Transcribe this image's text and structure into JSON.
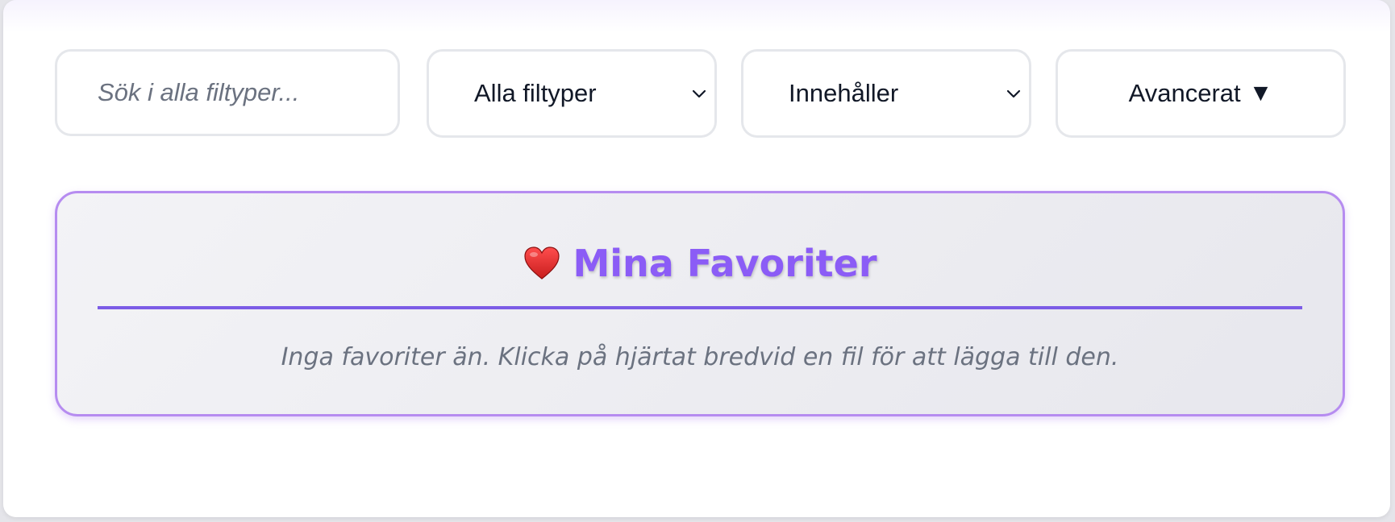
{
  "search": {
    "placeholder": "Sök i alla filtyper..."
  },
  "filters": {
    "file_type": {
      "selected": "Alla filtyper"
    },
    "match_mode": {
      "selected": "Innehåller"
    },
    "advanced_label": "Avancerat",
    "advanced_arrow": "▼"
  },
  "favorites": {
    "title": "Mina Favoriter",
    "empty_message": "Inga favoriter än. Klicka på hjärtat bredvid en fil för att lägga till den."
  },
  "colors": {
    "accent": "#8b5cf6",
    "heart": "#e02424"
  }
}
